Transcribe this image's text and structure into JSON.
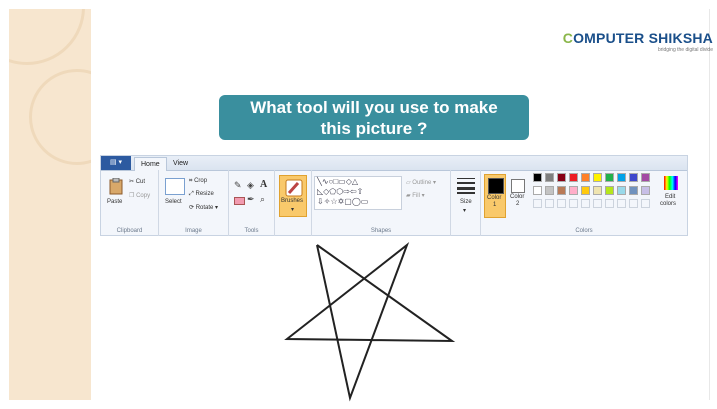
{
  "logo": {
    "brand_first": "C",
    "brand_rest": "OMPUTER SHIKSHA",
    "tagline": "bridging the digital divide"
  },
  "question": {
    "line1": "What tool will you use to make",
    "line2": "this picture ?"
  },
  "ribbon": {
    "tabs": [
      "Home",
      "View"
    ],
    "clipboard": {
      "paste": "Paste",
      "cut": "Cut",
      "copy": "Copy",
      "label": "Clipboard"
    },
    "image": {
      "select": "Select",
      "crop": "Crop",
      "resize": "Resize",
      "rotate": "Rotate",
      "label": "Image"
    },
    "tools": {
      "label": "Tools"
    },
    "brushes": {
      "label": "Brushes"
    },
    "shapes": {
      "outline": "Outline",
      "fill": "Fill",
      "label": "Shapes"
    },
    "size": {
      "label": "Size"
    },
    "colors": {
      "color1": "Color 1",
      "color1_l1": "Color",
      "color1_l2": "1",
      "color2_l1": "Color",
      "color2_l2": "2",
      "edit_l1": "Edit",
      "edit_l2": "colors",
      "label": "Colors",
      "palette_row1": [
        "#000000",
        "#7f7f7f",
        "#880015",
        "#ed1c24",
        "#ff7f27",
        "#fff200",
        "#22b14c",
        "#00a2e8",
        "#3f48cc",
        "#a349a4"
      ],
      "palette_row2": [
        "#ffffff",
        "#c3c3c3",
        "#b97a57",
        "#ffaec9",
        "#ffc90e",
        "#efe4b0",
        "#b5e61d",
        "#99d9ea",
        "#7092be",
        "#c8bfe7"
      ]
    }
  },
  "accent": "#3a8f9e"
}
